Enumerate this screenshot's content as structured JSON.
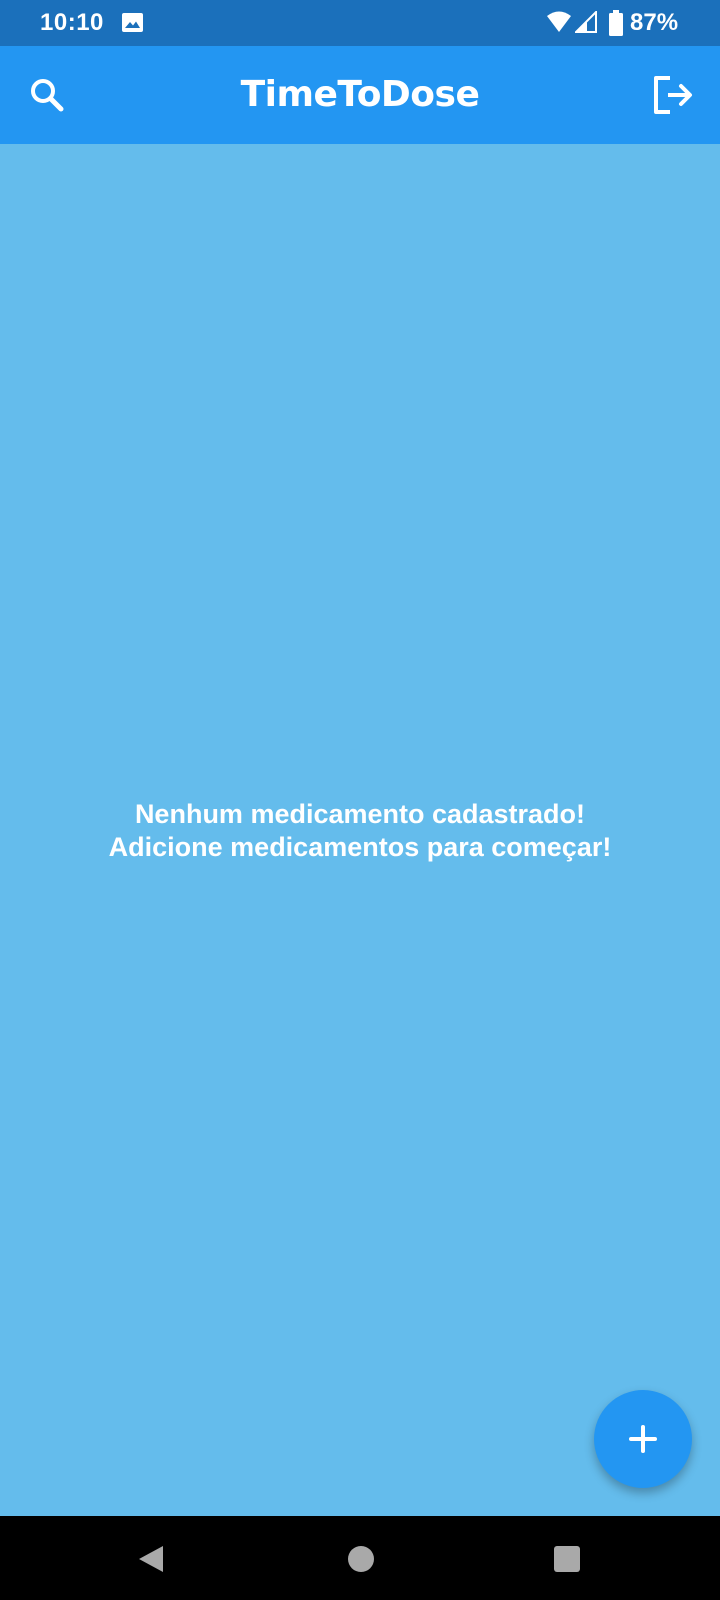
{
  "status_bar": {
    "time": "10:10",
    "battery_percent": "87%",
    "icons": [
      "image-icon",
      "wifi-icon",
      "signal-icon",
      "battery-icon"
    ]
  },
  "app_bar": {
    "title": "TimeToDose",
    "left_icon": "search-icon",
    "right_icon": "logout-icon"
  },
  "main": {
    "empty_line_1": "Nenhum medicamento cadastrado!",
    "empty_line_2": "Adicione medicamentos para começar!"
  },
  "fab": {
    "icon": "plus-icon"
  },
  "navigation_bar": {
    "icons": [
      "back-icon",
      "home-icon",
      "recents-icon"
    ]
  },
  "colors": {
    "status_bar": "#1B70BB",
    "app_bar": "#2396F2",
    "background": "#64BCEC",
    "fab": "#2396F2",
    "text": "#FFFFFF",
    "nav_bar": "#000000"
  }
}
